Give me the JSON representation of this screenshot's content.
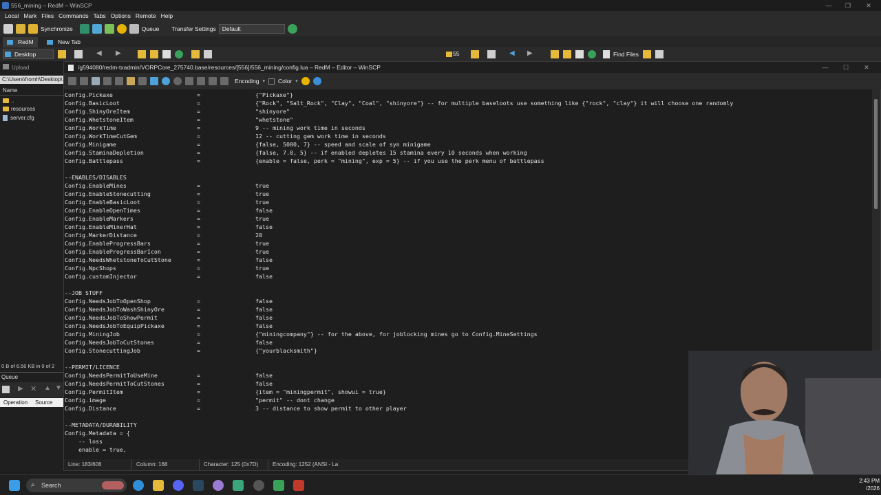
{
  "app": {
    "title": "556_mining – RedM – WinSCP",
    "menu": [
      "Local",
      "Mark",
      "Files",
      "Commands",
      "Tabs",
      "Options",
      "Remote",
      "Help"
    ],
    "toolbar": {
      "synchronize": "Synchronize",
      "queue": "Queue",
      "transfer_settings": "Transfer Settings",
      "transfer_preset": "Default"
    },
    "tabs": {
      "session": "RedM",
      "new_tab": "New Tab"
    },
    "local_path_combo": "Desktop",
    "remote_count": "55",
    "find_files": "Find Files",
    "upload": "Upload",
    "local_path": "C:\\Users\\fromh\\Desktop\\",
    "column_name": "Name",
    "files": [
      "..",
      "resources",
      "server.cfg"
    ],
    "selection_info": "0 B of 6.56 KB in 0 of 2",
    "queue": {
      "label": "Queue",
      "col_operation": "Operation",
      "col_source": "Source"
    }
  },
  "editor": {
    "title": "/g594080/redm-txadmin/VORPCore_275740.base/resources/[556]/556_mining/config.lua – RedM – Editor – WinSCP",
    "toolbar": {
      "encoding": "Encoding",
      "color": "Color"
    },
    "lines": [
      {
        "k": "Config.Pickaxe",
        "e": "=",
        "v": "{\"Pickaxe\"}"
      },
      {
        "k": "Config.BasicLoot",
        "e": "=",
        "v": "{\"Rock\", \"Salt_Rock\", \"Clay\", \"Coal\", \"shinyore\"} -- for multiple baseloots use something like {\"rock\", \"clay\"} it will choose one randomly"
      },
      {
        "k": "Config.ShinyOreItem",
        "e": "=",
        "v": "\"shinyore\""
      },
      {
        "k": "Config.WhetstoneItem",
        "e": "=",
        "v": "\"whetstone\""
      },
      {
        "k": "Config.WorkTime",
        "e": "=",
        "v": "9 -- mining work time in seconds"
      },
      {
        "k": "Config.WorkTimeCutGem",
        "e": "=",
        "v": "12 -- cutting gem work time in seconds"
      },
      {
        "k": "Config.Minigame",
        "e": "=",
        "v": "{false, 5000, 7} -- speed and scale of syn minigame"
      },
      {
        "k": "Config.StaminaDepletion",
        "e": "=",
        "v": "{false, 7.0, 5} -- if enabled depletes 15 stamina every 10 seconds when working"
      },
      {
        "k": "Config.Battlepass",
        "e": "=",
        "v": "{enable = false, perk = \"mining\", exp = 5} -- if you use the perk menu of battlepass"
      },
      {
        "k": "",
        "e": "",
        "v": ""
      },
      {
        "k": "--ENABLES/DISABLES",
        "e": "",
        "v": ""
      },
      {
        "k": "Config.EnableMines",
        "e": "=",
        "v": "true"
      },
      {
        "k": "Config.EnableStonecutting",
        "e": "=",
        "v": "true"
      },
      {
        "k": "Config.EnableBasicLoot",
        "e": "=",
        "v": "true"
      },
      {
        "k": "Config.EnableOpenTimes",
        "e": "=",
        "v": "false"
      },
      {
        "k": "Config.EnableMarkers",
        "e": "=",
        "v": "true"
      },
      {
        "k": "Config.EnableMinerHat",
        "e": "=",
        "v": "false"
      },
      {
        "k": "Config.MarkerDistance",
        "e": "=",
        "v": "20"
      },
      {
        "k": "Config.EnableProgressBars",
        "e": "=",
        "v": "true"
      },
      {
        "k": "Config.EnableProgressBarIcon",
        "e": "=",
        "v": "true"
      },
      {
        "k": "Config.NeedsWhetstoneToCutStone",
        "e": "=",
        "v": "false"
      },
      {
        "k": "Config.NpcShops",
        "e": "=",
        "v": "true"
      },
      {
        "k": "Config.customInjector",
        "e": "=",
        "v": "false"
      },
      {
        "k": "",
        "e": "",
        "v": ""
      },
      {
        "k": "--JOB STUFF",
        "e": "",
        "v": ""
      },
      {
        "k": "Config.NeedsJobToOpenShop",
        "e": "=",
        "v": "false"
      },
      {
        "k": "Config.NeedsJobToWashShinyOre",
        "e": "=",
        "v": "false"
      },
      {
        "k": "Config.NeedsJobToShowPermit",
        "e": "=",
        "v": "false"
      },
      {
        "k": "Config.NeedsJobToEquipPickaxe",
        "e": "=",
        "v": "false"
      },
      {
        "k": "Config.MiningJob",
        "e": "=",
        "v": "{\"miningcompany\"} -- for the above, for joblocking mines go to Config.MineSettings"
      },
      {
        "k": "Config.NeedsJobToCutStones",
        "e": "=",
        "v": "false"
      },
      {
        "k": "Config.StonecuttingJob",
        "e": "=",
        "v": "{\"yourblacksmith\"}"
      },
      {
        "k": "",
        "e": "",
        "v": ""
      },
      {
        "k": "--PERMIT/LICENCE",
        "e": "",
        "v": ""
      },
      {
        "k": "Config.NeedsPermitToUseMine",
        "e": "=",
        "v": "false"
      },
      {
        "k": "Config.NeedsPermitToCutStones",
        "e": "=",
        "v": "false"
      },
      {
        "k": "Config.PermitItem",
        "e": "=",
        "v": "{item = \"miningpermit\", showui = true}"
      },
      {
        "k": "Config.image",
        "e": "=",
        "v": "\"permit\" -- dont change"
      },
      {
        "k": "Config.Distance",
        "e": "=",
        "v": "3 -- distance to show permit to other player"
      },
      {
        "k": "",
        "e": "",
        "v": ""
      },
      {
        "k": "--METADATA/DURABILITY",
        "e": "",
        "v": ""
      },
      {
        "k": "Config.Metadata = {",
        "e": "",
        "v": ""
      },
      {
        "k": "    -- loss",
        "e": "",
        "v": ""
      },
      {
        "k": "    enable = true,",
        "e": "",
        "v": ""
      }
    ],
    "status": {
      "line": "Line: 183/606",
      "column": "Column: 168",
      "character": "Character: 125 (0x7D)",
      "encoding": "Encoding: 1252  (ANSI - La"
    }
  },
  "taskbar": {
    "search": "Search",
    "time": "2:43 PM",
    "date": "/2026"
  }
}
